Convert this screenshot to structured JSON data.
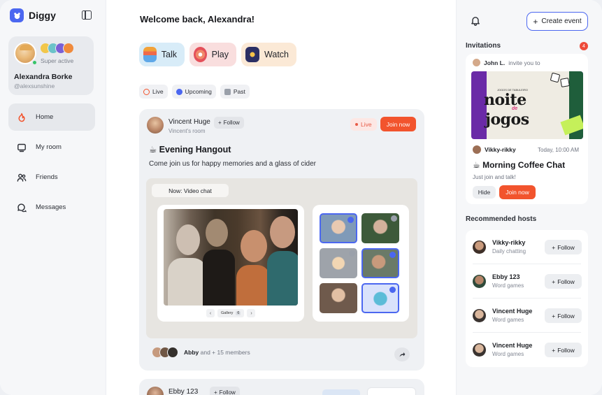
{
  "brand": {
    "name": "Diggy"
  },
  "profile": {
    "status": "Super active",
    "name": "Alexandra Borke",
    "handle": "@alexsunshine"
  },
  "nav": [
    {
      "label": "Home",
      "icon": "flame-icon",
      "active": true
    },
    {
      "label": "My room",
      "icon": "room-icon",
      "active": false
    },
    {
      "label": "Friends",
      "icon": "friends-icon",
      "active": false
    },
    {
      "label": "Messages",
      "icon": "messages-icon",
      "active": false
    }
  ],
  "main": {
    "welcome": "Welcome back, Alexandra!",
    "modes": [
      {
        "label": "Talk",
        "icon": "talk-icon"
      },
      {
        "label": "Play",
        "icon": "play-icon"
      },
      {
        "label": "Watch",
        "icon": "watch-icon"
      }
    ],
    "filters": [
      {
        "label": "Live",
        "color": "#f2542d"
      },
      {
        "label": "Upcoming",
        "color": "#4b67f0"
      },
      {
        "label": "Past",
        "color": "#9aa0aa"
      }
    ],
    "event": {
      "host": "Vincent Huge",
      "room": "Vincent's room",
      "follow": "Follow",
      "live": "Live",
      "join": "Join now",
      "title": "☕ Evening Hangout",
      "description": "Come join us for happy memories and a glass of cider",
      "now": "Now: Video chat",
      "gallery": "Gallery",
      "gallery_count": "6",
      "members_name": "Abby",
      "members_rest": " and + 15 members"
    },
    "event2": {
      "host": "Ebby 123",
      "follow": "Follow"
    }
  },
  "right": {
    "create": "Create event",
    "invitations_title": "Invitations",
    "invitations_count": "4",
    "invite": {
      "from": "John L.",
      "from_suffix": "invite you to",
      "poster_small": "JOGOS DE TABULEIRO",
      "poster_line1": "noite",
      "poster_de": "de",
      "poster_line2": "jogos",
      "host": "Vikky-rikky",
      "time": "Today, 10:00 AM",
      "title": "☕ Morning Coffee Chat",
      "description": "Just join and talk!",
      "hide": "Hide",
      "join": "Join now"
    },
    "recommended_title": "Recommended hosts",
    "hosts": [
      {
        "name": "Vikky-rikky",
        "sub": "Daily chatting",
        "follow": "Follow"
      },
      {
        "name": "Ebby 123",
        "sub": "Word games",
        "follow": "Follow"
      },
      {
        "name": "Vincent Huge",
        "sub": "Word games",
        "follow": "Follow"
      },
      {
        "name": "Vincent Huge",
        "sub": "Word games",
        "follow": "Follow"
      }
    ]
  },
  "colors": {
    "accent": "#4b67f0",
    "primary_action": "#f2542d",
    "live": "#e85a45"
  }
}
